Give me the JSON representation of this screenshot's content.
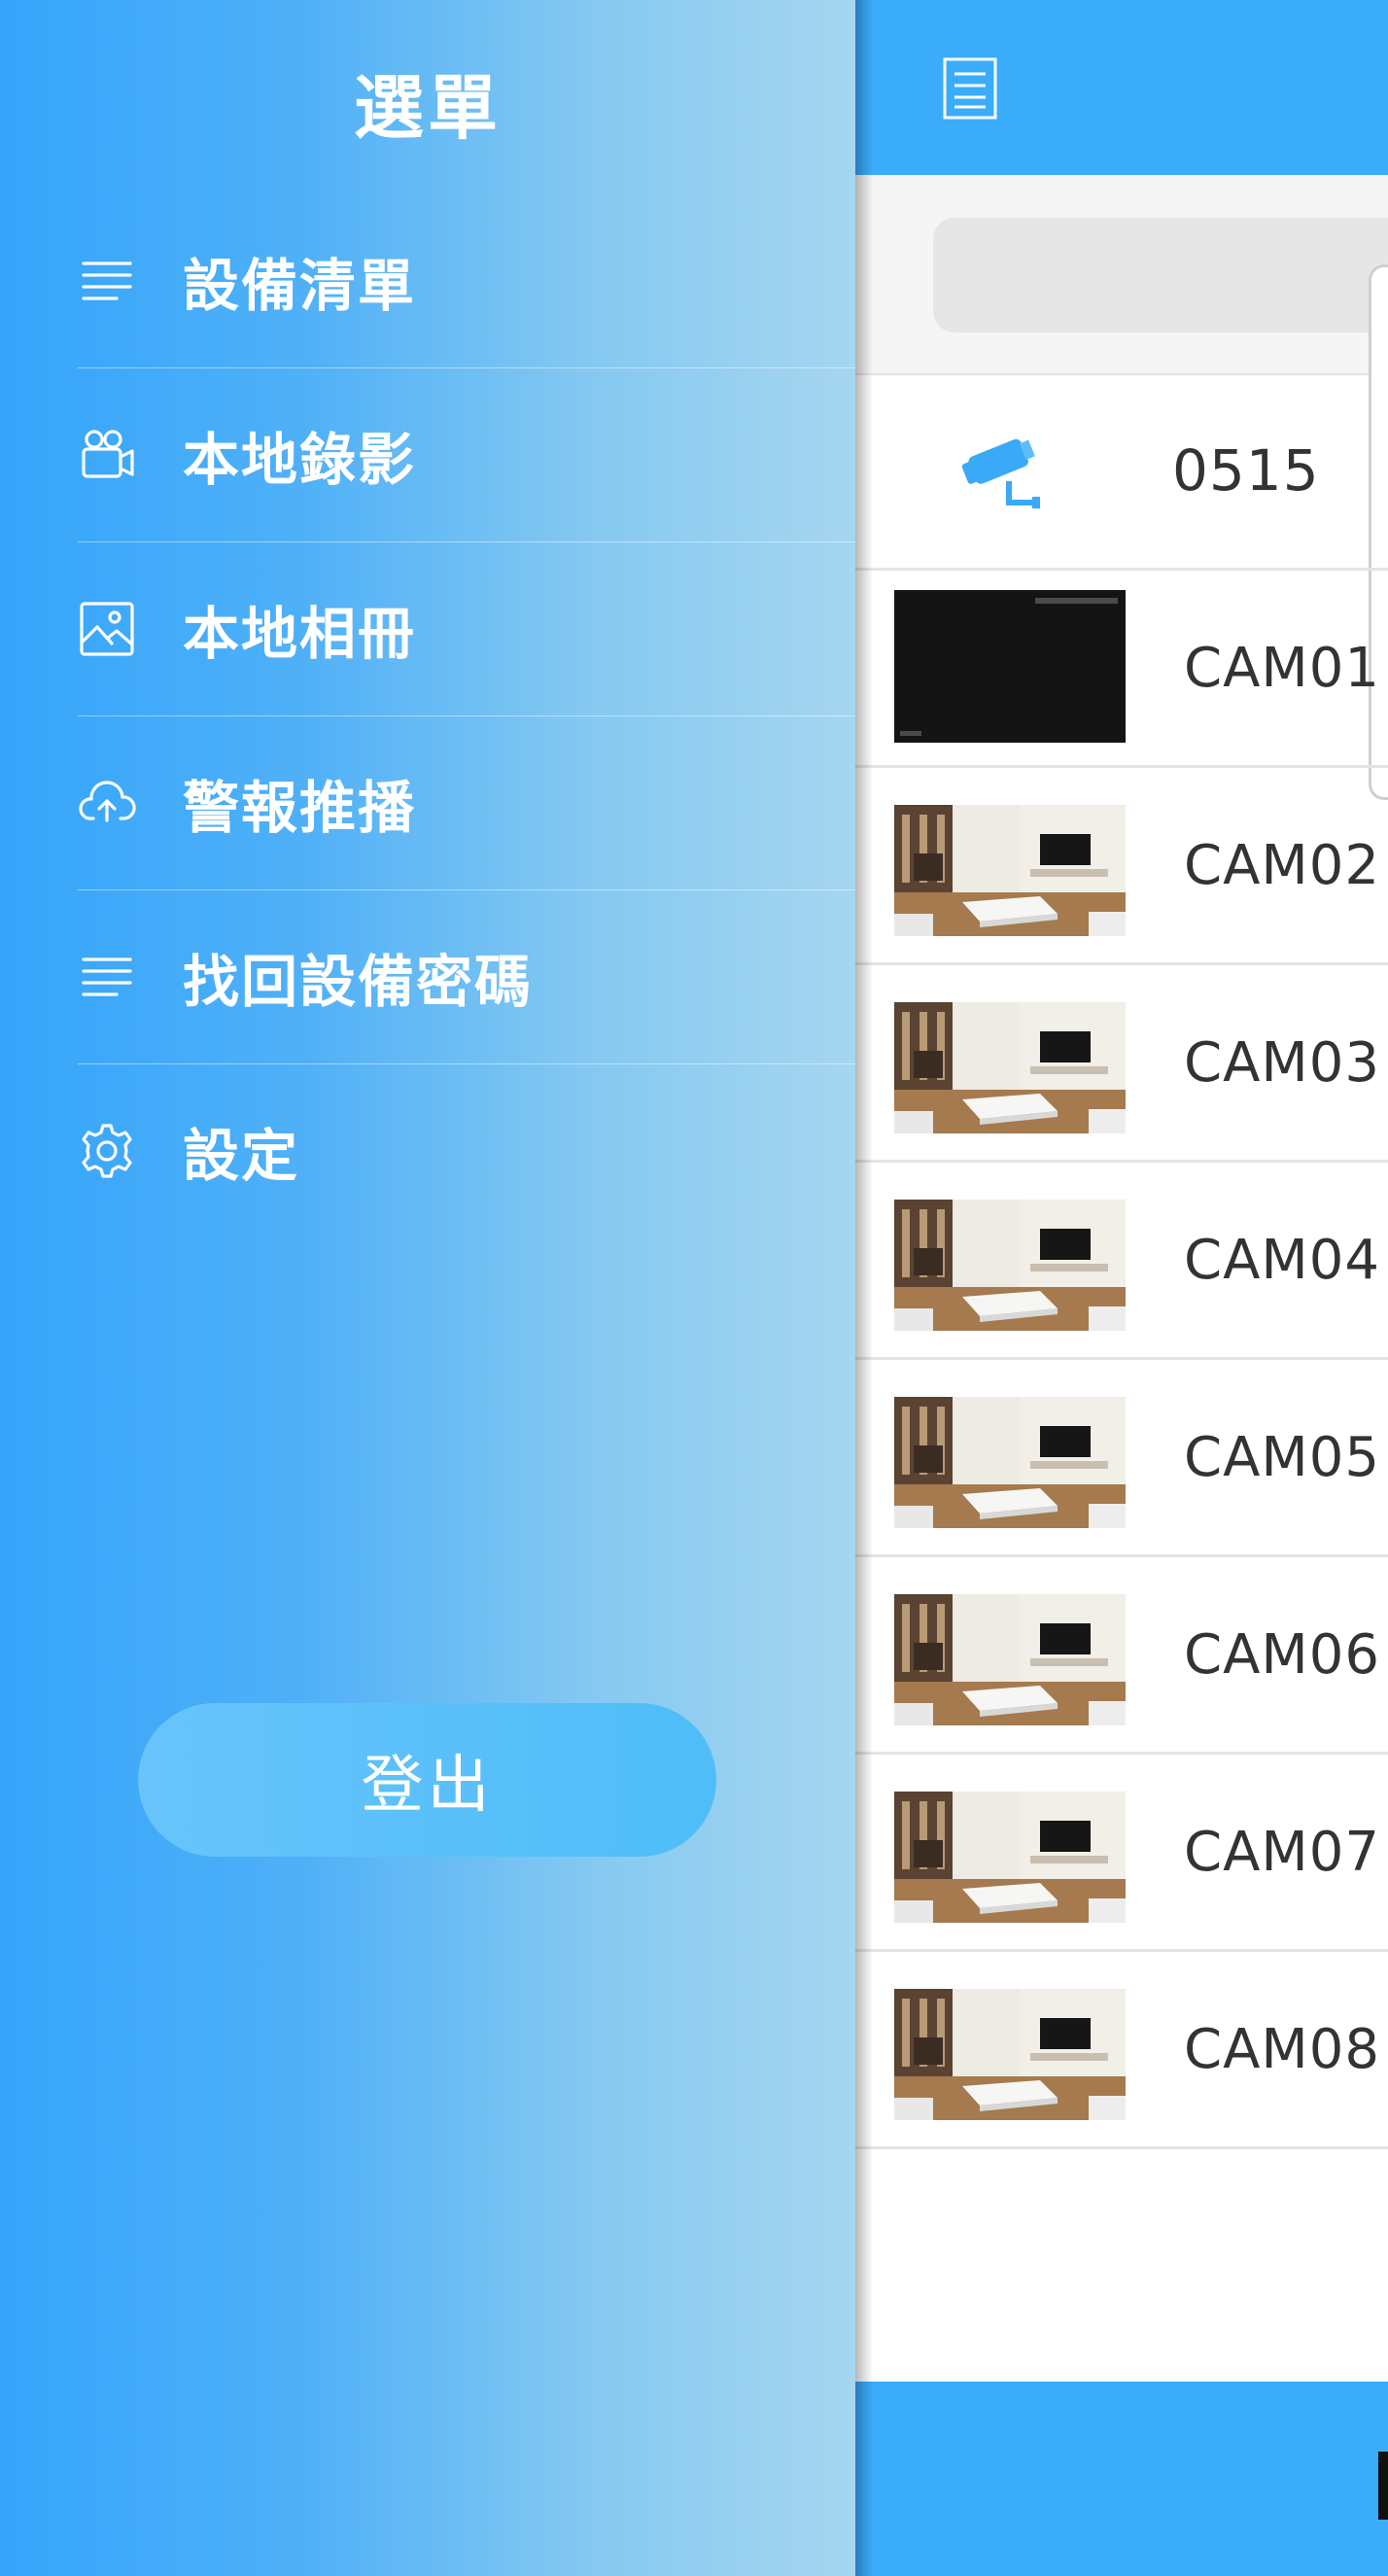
{
  "drawer": {
    "title": "選單",
    "items": [
      {
        "label": "設備清單",
        "icon": "list-icon"
      },
      {
        "label": "本地錄影",
        "icon": "video-camera-icon"
      },
      {
        "label": "本地相冊",
        "icon": "image-icon"
      },
      {
        "label": "警報推播",
        "icon": "cloud-upload-icon"
      },
      {
        "label": "找回設備密碼",
        "icon": "list-icon"
      },
      {
        "label": "設定",
        "icon": "gear-icon"
      }
    ],
    "logout_label": "登出"
  },
  "main": {
    "topbar_icon": "document-icon",
    "search": {
      "placeholder": ""
    },
    "device_group": {
      "label": "0515",
      "icon": "cctv-camera-icon"
    },
    "cameras": [
      {
        "label": "CAM01",
        "thumb": "dark"
      },
      {
        "label": "CAM02",
        "thumb": "room"
      },
      {
        "label": "CAM03",
        "thumb": "room"
      },
      {
        "label": "CAM04",
        "thumb": "room"
      },
      {
        "label": "CAM05",
        "thumb": "room"
      },
      {
        "label": "CAM06",
        "thumb": "room"
      },
      {
        "label": "CAM07",
        "thumb": "room"
      },
      {
        "label": "CAM08",
        "thumb": "room"
      }
    ]
  },
  "colors": {
    "accent": "#3aacfa",
    "drawer_start": "#35a5fb",
    "drawer_end": "#a6d6f0",
    "logout_button": "#5ec0f9"
  }
}
